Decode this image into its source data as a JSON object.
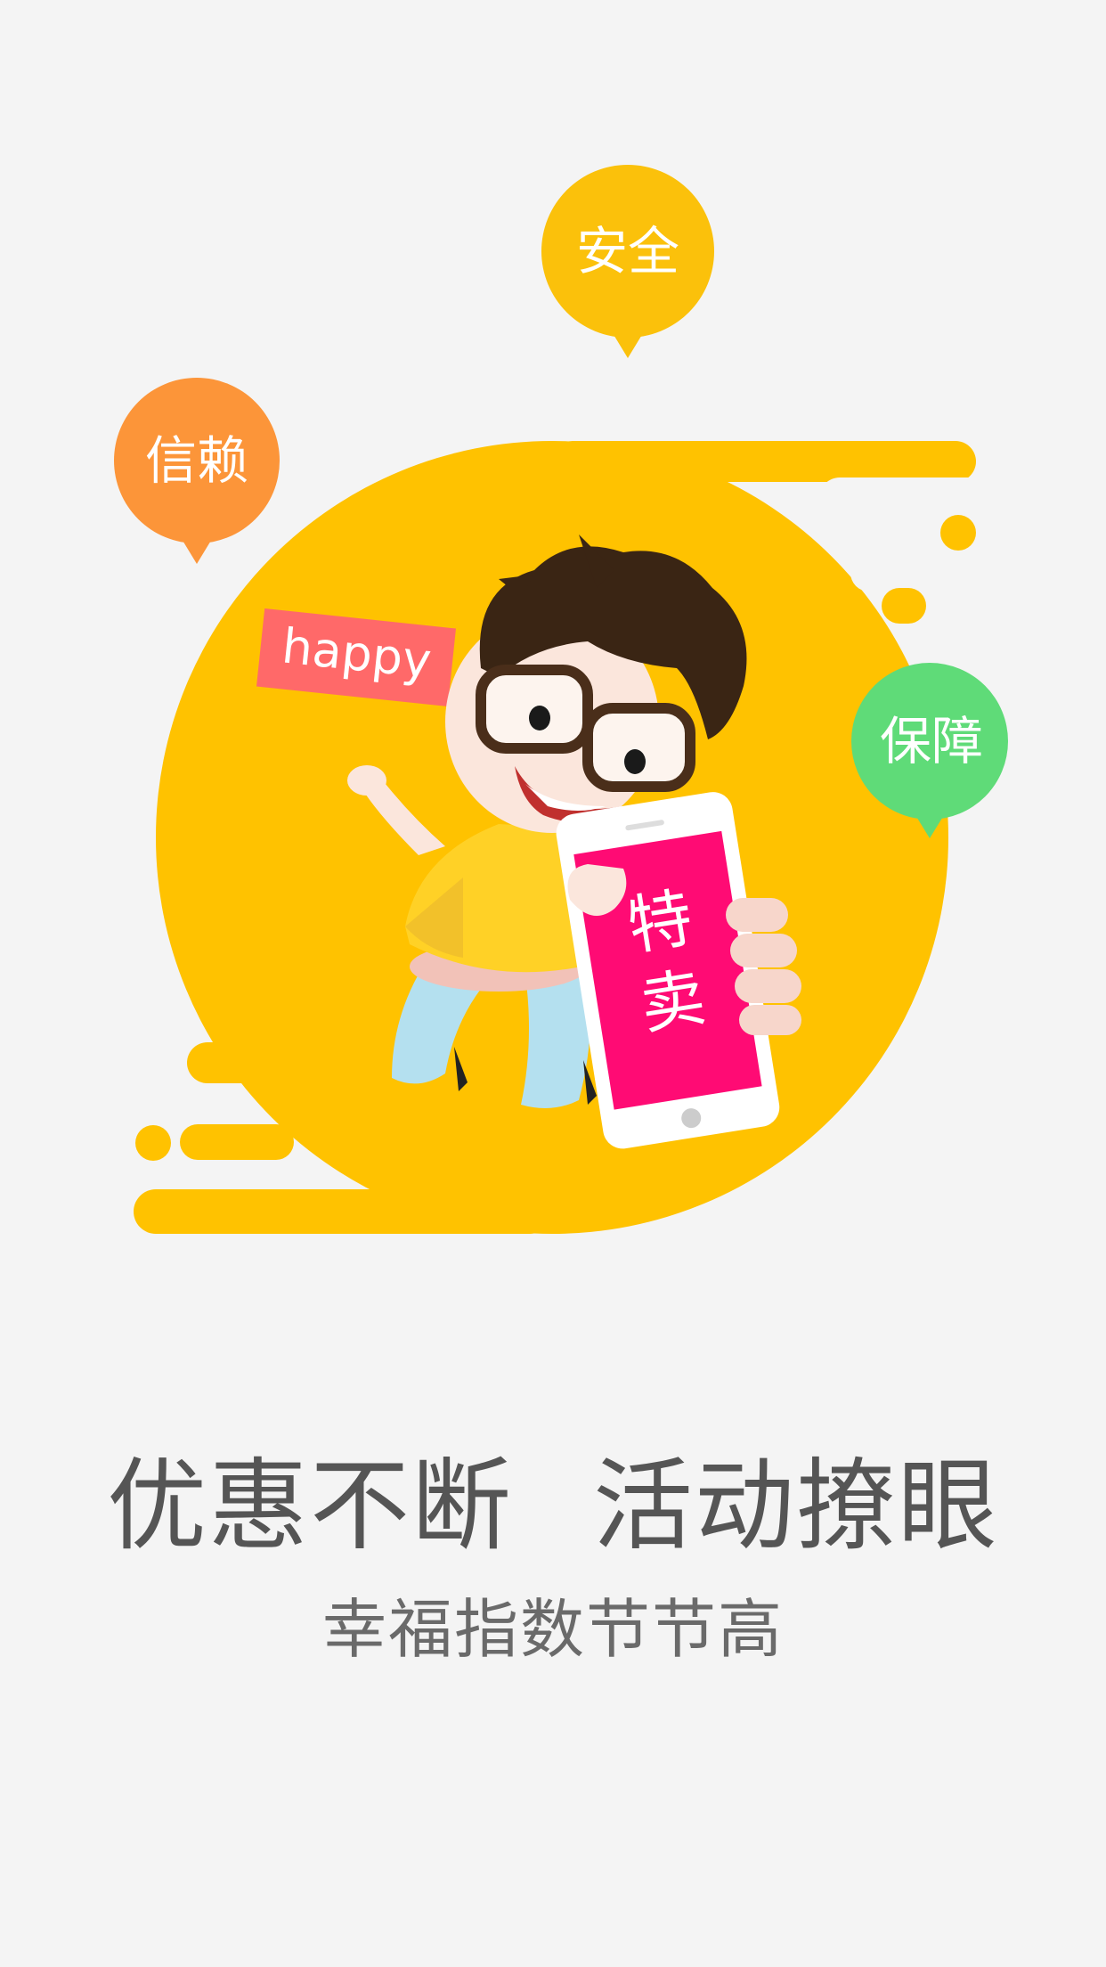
{
  "badges": {
    "safety": "安全",
    "trust": "信赖",
    "guarantee": "保障"
  },
  "sign_text": "happy",
  "phone_text": [
    "特",
    "卖"
  ],
  "headline": {
    "left": "优惠不断",
    "right": "活动撩眼"
  },
  "subheadline": "幸福指数节节高",
  "colors": {
    "background": "#f4f4f4",
    "blob": "#ffc200",
    "badge_safety": "#fbc10b",
    "badge_trust": "#fc9539",
    "badge_guarantee": "#5fdb78",
    "sign": "#ff6969",
    "phone_screen": "#ff0b74",
    "text": "#555555"
  }
}
